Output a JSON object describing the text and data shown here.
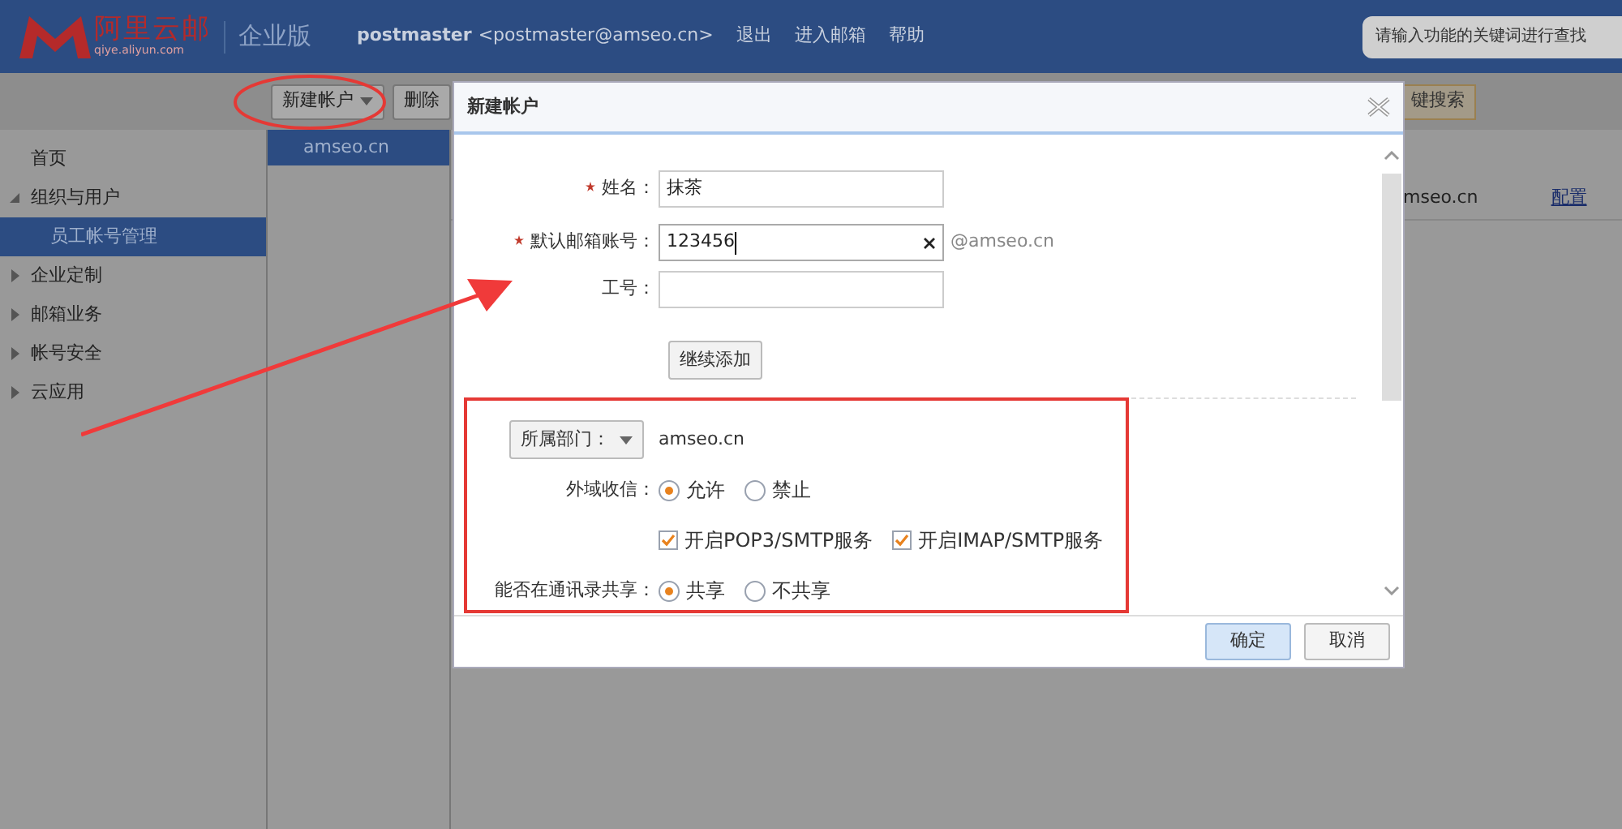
{
  "header": {
    "logo_text": "阿里云邮",
    "logo_sub": "qiye.aliyun.com",
    "edition": "企业版",
    "user": "postmaster",
    "email": "<postmaster@amseo.cn>",
    "links": [
      "退出",
      "进入邮箱",
      "帮助"
    ],
    "search": {
      "placeholder": "请输入功能的关键词进行查找"
    }
  },
  "toolbar": {
    "new_button": "新建帐户",
    "delete_button": "删除",
    "search_button": "键搜索"
  },
  "sidebar": {
    "items": [
      {
        "label": "首页"
      },
      {
        "label": "组织与用户",
        "expanded": true,
        "children": [
          {
            "label": "员工帐号管理",
            "selected": true
          }
        ]
      },
      {
        "label": "企业定制",
        "expanded": false
      },
      {
        "label": "邮箱业务",
        "expanded": false
      },
      {
        "label": "帐号安全",
        "expanded": false
      },
      {
        "label": "云应用",
        "expanded": false
      }
    ]
  },
  "domains": [
    {
      "label": "amseo.cn",
      "selected": true
    }
  ],
  "content": {
    "domain": "mseo.cn",
    "link": "配置"
  },
  "dialog": {
    "title": "新建帐户",
    "fields": [
      {
        "label": "姓名：",
        "required": true,
        "value": "抹茶",
        "focused": false
      },
      {
        "label": "默认邮箱账号：",
        "required": true,
        "value": "123456",
        "focused": true,
        "suffix": "@amseo.cn"
      },
      {
        "label": "工号：",
        "required": false,
        "focused": false
      }
    ],
    "continue_button": "继续添加",
    "department": {
      "button": "所属部门：",
      "value": "amseo.cn"
    },
    "external_mail": {
      "label": "外域收信：",
      "options": [
        {
          "label": "允许",
          "selected": true
        },
        {
          "label": "禁止",
          "selected": false
        }
      ]
    },
    "services": [
      {
        "label": "开启POP3/SMTP服务",
        "checked": true
      },
      {
        "label": "开启IMAP/SMTP服务",
        "checked": true
      }
    ],
    "share": {
      "label": "能否在通讯录共享：",
      "options": [
        {
          "label": "共享",
          "selected": true
        },
        {
          "label": "不共享",
          "selected": false
        }
      ]
    },
    "buttons": [
      {
        "label": "确定",
        "primary": true
      },
      {
        "label": "取消",
        "primary": false
      }
    ]
  }
}
